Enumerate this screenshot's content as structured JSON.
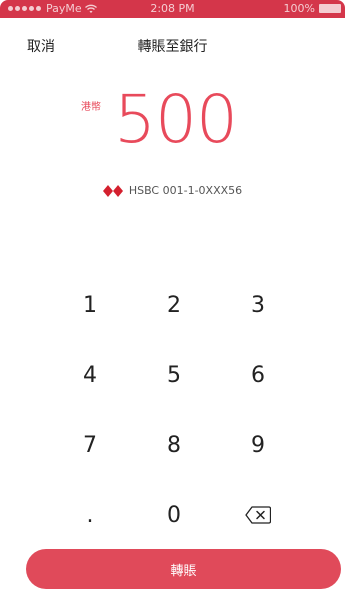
{
  "status_bar": {
    "carrier": "PayMe",
    "time": "2:08 PM",
    "battery": "100%",
    "icons": [
      "signal-dots-icon",
      "wifi-icon",
      "battery-icon"
    ]
  },
  "nav": {
    "cancel_label": "取消",
    "title": "轉賬至銀行"
  },
  "amount": {
    "currency": "港幣",
    "value": "500"
  },
  "account": {
    "bank_icon": "hsbc-logo-icon",
    "label": "HSBC 001-1-0XXX56"
  },
  "keypad": {
    "keys": [
      "1",
      "2",
      "3",
      "4",
      "5",
      "6",
      "7",
      "8",
      "9",
      ".",
      "0"
    ],
    "delete_icon": "backspace-icon"
  },
  "action": {
    "transfer_label": "轉賬"
  },
  "colors": {
    "accent": "#e84a5b",
    "button": "#e04a5a",
    "status_bar": "#d4364a"
  }
}
